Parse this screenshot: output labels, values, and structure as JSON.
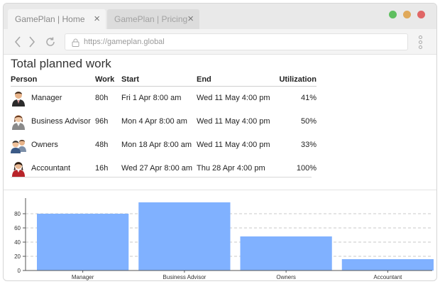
{
  "browser": {
    "tabs": [
      {
        "label": "GamePlan | Home",
        "active": true
      },
      {
        "label": "GamePlan | Pricing",
        "active": false
      }
    ],
    "tab_close_glyph": "×",
    "url": "https://gameplan.global",
    "window_buttons": {
      "colors": [
        "#5fbf60",
        "#e0a95a",
        "#e06666"
      ]
    },
    "icons": [
      "back-arrow-icon",
      "forward-arrow-icon",
      "reload-icon",
      "lock-icon",
      "kebab-menu-icon"
    ]
  },
  "page": {
    "title": "Total planned work",
    "columns": {
      "person": "Person",
      "work": "Work",
      "start": "Start",
      "end": "End",
      "utilization": "Utilization"
    },
    "rows": [
      {
        "person": "Manager",
        "work": "80h",
        "start": "Fri 1 Apr 8:00 am",
        "end": "Wed 11 May 4:00 pm",
        "utilization": "41%",
        "icon": "manager-avatar-icon"
      },
      {
        "person": "Business Advisor",
        "work": "96h",
        "start": "Mon 4 Apr 8:00 am",
        "end": "Wed 11 May 4:00 pm",
        "utilization": "50%",
        "icon": "business-advisor-avatar-icon"
      },
      {
        "person": "Owners",
        "work": "48h",
        "start": "Mon 18 Apr 8:00 am",
        "end": "Wed 11 May 4:00 pm",
        "utilization": "33%",
        "icon": "owners-avatar-icon"
      },
      {
        "person": "Accountant",
        "work": "16h",
        "start": "Wed 27 Apr 8:00 am",
        "end": "Thu 28 Apr 4:00 pm",
        "utilization": "100%",
        "icon": "accountant-avatar-icon"
      }
    ]
  },
  "chart_data": {
    "type": "bar",
    "categories": [
      "Manager",
      "Business Advisor",
      "Owners",
      "Accountant"
    ],
    "values": [
      80,
      96,
      48,
      16
    ],
    "yticks": [
      0,
      20,
      40,
      60,
      80
    ],
    "ylim": [
      0,
      100
    ],
    "grid": true,
    "bar_color": "#80b1ff",
    "title": "",
    "xlabel": "",
    "ylabel": ""
  }
}
